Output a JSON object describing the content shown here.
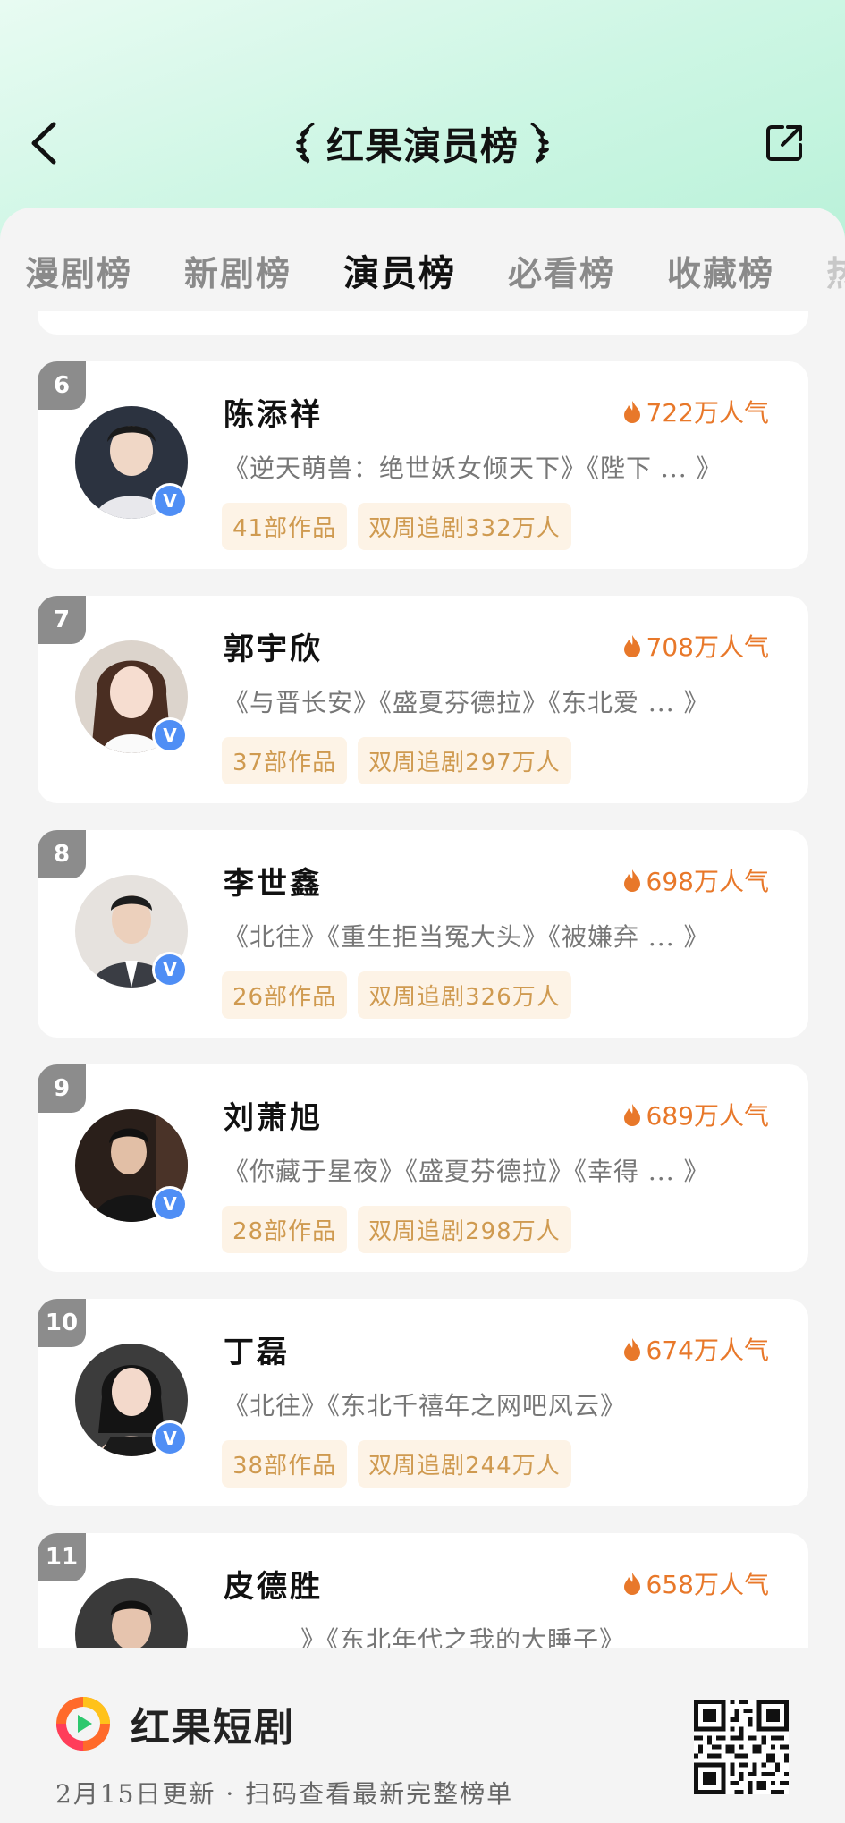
{
  "header": {
    "title": "红果演员榜"
  },
  "tabs": [
    {
      "label": "漫剧榜",
      "active": false
    },
    {
      "label": "新剧榜",
      "active": false
    },
    {
      "label": "演员榜",
      "active": true
    },
    {
      "label": "必看榜",
      "active": false
    },
    {
      "label": "收藏榜",
      "active": false
    }
  ],
  "actors": [
    {
      "rank": "6",
      "name": "陈添祥",
      "heat": "722万人气",
      "works": "《逆天萌兽：绝世妖女倾天下》《陛下 ... 》",
      "count": "41部作品",
      "followers": "双周追剧332万人"
    },
    {
      "rank": "7",
      "name": "郭宇欣",
      "heat": "708万人气",
      "works": "《与晋长安》《盛夏芬德拉》《东北爱 ... 》",
      "count": "37部作品",
      "followers": "双周追剧297万人"
    },
    {
      "rank": "8",
      "name": "李世鑫",
      "heat": "698万人气",
      "works": "《北往》《重生拒当冤大头》《被嫌弃 ... 》",
      "count": "26部作品",
      "followers": "双周追剧326万人"
    },
    {
      "rank": "9",
      "name": "刘萧旭",
      "heat": "689万人气",
      "works": "《你藏于星夜》《盛夏芬德拉》《幸得 ... 》",
      "count": "28部作品",
      "followers": "双周追剧298万人"
    },
    {
      "rank": "10",
      "name": "丁磊",
      "heat": "674万人气",
      "works": "《北往》《东北千禧年之网吧风云》",
      "count": "38部作品",
      "followers": "双周追剧244万人"
    },
    {
      "rank": "11",
      "name": "皮德胜",
      "heat": "658万人气",
      "works": "》《东北年代之我的大睡子》",
      "count": "",
      "followers": ""
    }
  ],
  "footer": {
    "brand": "红果短剧",
    "update": "2月15日更新 · 扫码查看最新完整榜单"
  },
  "colors": {
    "accent_orange": "#e8782a",
    "tag_bg": "#fdf3e6",
    "tag_text": "#cf9a50",
    "verify_blue": "#4f8ef5",
    "rank_gray": "#8c8c8c"
  }
}
